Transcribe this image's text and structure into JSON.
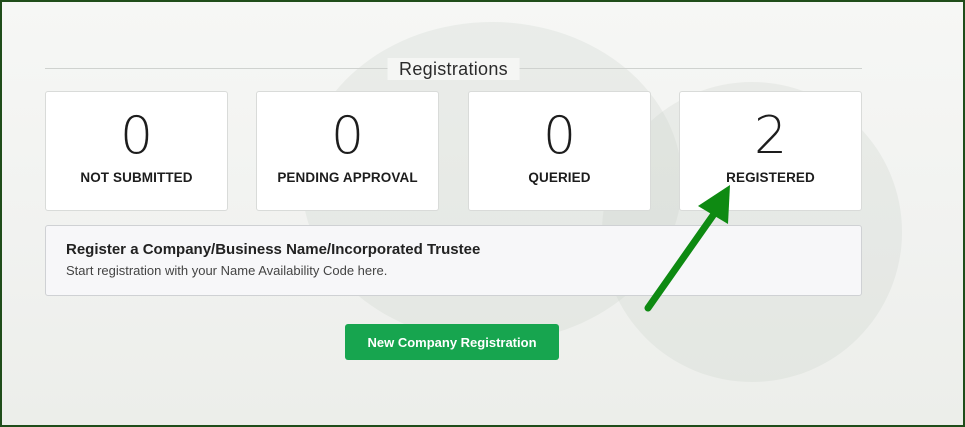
{
  "section": {
    "title": "Registrations"
  },
  "stats": [
    {
      "count": "0",
      "label": "NOT SUBMITTED"
    },
    {
      "count": "0",
      "label": "PENDING APPROVAL"
    },
    {
      "count": "0",
      "label": "QUERIED"
    },
    {
      "count": "2",
      "label": "REGISTERED"
    }
  ],
  "register_box": {
    "heading": "Register a Company/Business Name/Incorporated Trustee",
    "subtext": "Start registration with your Name Availability Code here."
  },
  "actions": {
    "new_registration_label": "New Company Registration"
  },
  "colors": {
    "frame_border": "#1f4d1a",
    "button_bg": "#17a54f",
    "annotation_arrow": "#0e8a12"
  },
  "annotation": {
    "icon": "arrow-icon"
  }
}
